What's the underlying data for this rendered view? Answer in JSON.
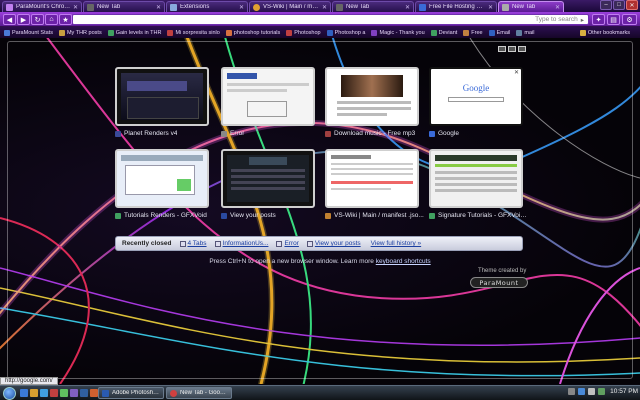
{
  "tabs": [
    {
      "title": "ParaMount's Chrome Th",
      "active": false,
      "favicon": "chrome-theme-icon"
    },
    {
      "title": "New Tab",
      "active": false,
      "favicon": "blank-page-icon"
    },
    {
      "title": "Extensions",
      "active": false,
      "favicon": "extensions-icon"
    },
    {
      "title": "VS-Wiki | Main / manif",
      "active": false,
      "favicon": "wiki-icon"
    },
    {
      "title": "New Tab",
      "active": false,
      "favicon": "blank-page-icon"
    },
    {
      "title": "Free File Hosting Made",
      "active": false,
      "favicon": "file-hosting-icon"
    },
    {
      "title": "New Tab",
      "active": true,
      "favicon": "blank-page-icon"
    }
  ],
  "toolbar": {
    "omnibox_placeholder": "Type to search"
  },
  "bookmarks": [
    {
      "label": "ParaMount Stats",
      "color": "#4a7ad8"
    },
    {
      "label": "My THR posts",
      "color": "#c8a040"
    },
    {
      "label": "Gain levels in THR",
      "color": "#40a060"
    },
    {
      "label": "Mi sorpresita sinlo",
      "color": "#c04040"
    },
    {
      "label": "photoshop tutorials",
      "color": "#d87040"
    },
    {
      "label": "Photoshop",
      "color": "#c04040"
    },
    {
      "label": "Photoshop a",
      "color": "#3060c0"
    },
    {
      "label": "Magic - Thank you",
      "color": "#8040c0"
    },
    {
      "label": "Deviant",
      "color": "#40a060"
    },
    {
      "label": "Free",
      "color": "#c08040"
    },
    {
      "label": "Email",
      "color": "#3060c0"
    },
    {
      "label": "mail",
      "color": "#6080a0"
    }
  ],
  "other_bookmarks": "Other bookmarks",
  "thumbnails": [
    {
      "title": "Planet Renders v4",
      "favicon_color": "#3a4a9a"
    },
    {
      "title": "Error",
      "favicon_color": "#888888"
    },
    {
      "title": "Download music - Free mp3",
      "favicon_color": "#a04040"
    },
    {
      "title": "Google",
      "favicon_color": "#3a6ad8"
    },
    {
      "title": "Tutorials Renders - GFXVoid",
      "favicon_color": "#40a060"
    },
    {
      "title": "View your posts",
      "favicon_color": "#2a4aa0"
    },
    {
      "title": "VS-Wiki | Main / manifest .jso...",
      "favicon_color": "#c08030"
    },
    {
      "title": "Signature Tutorials - GFXVoid...",
      "favicon_color": "#40a060"
    }
  ],
  "recently_closed": {
    "heading": "Recently closed",
    "items": [
      {
        "label": "4 Tabs",
        "icon": "tabs-icon"
      },
      {
        "label": "InformationUs...",
        "icon": "page-icon"
      },
      {
        "label": "Error",
        "icon": "page-icon"
      },
      {
        "label": "View your posts",
        "icon": "page-icon"
      }
    ],
    "view_full_history": "View full history »"
  },
  "tip": {
    "text": "Press Ctrl+N to open a new browser window. Learn more",
    "link": "keyboard shortcuts"
  },
  "theme_credit": "Theme created by",
  "theme_logo": "ParaMount",
  "status_url": "http://google.com/",
  "taskbar": {
    "tasks": [
      {
        "label": "Adobe Photoshop C...",
        "icon_color": "#2a5ab0"
      },
      {
        "label": "New Tab - Google C...",
        "icon_color": "#d04040"
      }
    ],
    "clock": "10:57 PM"
  }
}
